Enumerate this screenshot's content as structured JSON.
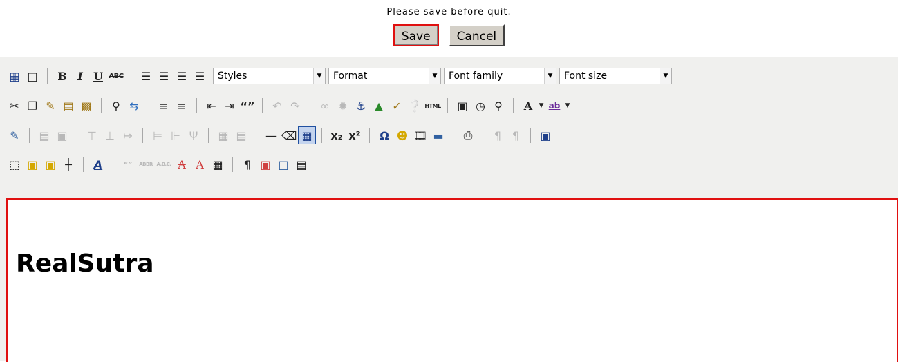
{
  "notice": "Please save before quit.",
  "buttons": {
    "save": "Save",
    "cancel": "Cancel"
  },
  "toolbar": {
    "styles": "Styles",
    "format": "Format",
    "font_family": "Font family",
    "font_size": "Font size",
    "bold": "B",
    "italic": "I",
    "underline": "U",
    "strike": "ABC",
    "html": "HTML",
    "abbr": "ABBR",
    "acronym": "A.B.C.",
    "cite": "“”",
    "font_color": "A",
    "highlight": "ab",
    "styleprops": "A"
  },
  "content": {
    "heading": "RealSutra"
  },
  "colors": {
    "accent_border": "#e01010",
    "toolbar_bg": "#f0f0ee"
  }
}
